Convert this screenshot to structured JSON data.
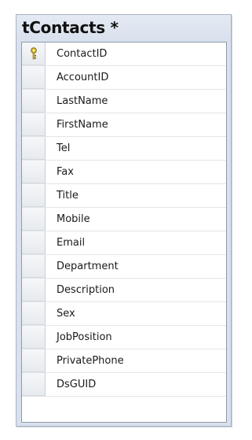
{
  "table": {
    "title": "tContacts *",
    "primary_key_icon": "key-icon",
    "columns": [
      {
        "name": "ContactID",
        "is_primary_key": true
      },
      {
        "name": "AccountID",
        "is_primary_key": false
      },
      {
        "name": "LastName",
        "is_primary_key": false
      },
      {
        "name": "FirstName",
        "is_primary_key": false
      },
      {
        "name": "Tel",
        "is_primary_key": false
      },
      {
        "name": "Fax",
        "is_primary_key": false
      },
      {
        "name": "Title",
        "is_primary_key": false
      },
      {
        "name": "Mobile",
        "is_primary_key": false
      },
      {
        "name": "Email",
        "is_primary_key": false
      },
      {
        "name": "Department",
        "is_primary_key": false
      },
      {
        "name": "Description",
        "is_primary_key": false
      },
      {
        "name": "Sex",
        "is_primary_key": false
      },
      {
        "name": "JobPosition",
        "is_primary_key": false
      },
      {
        "name": "PrivatePhone",
        "is_primary_key": false
      },
      {
        "name": "DsGUID",
        "is_primary_key": false
      }
    ]
  },
  "colors": {
    "title_bar": "#d9e1ee",
    "key_icon": "#e3c23a"
  }
}
